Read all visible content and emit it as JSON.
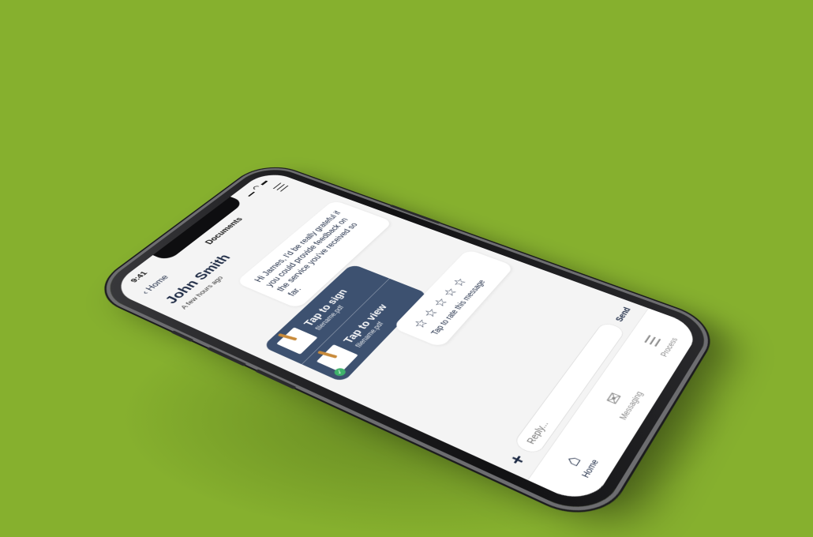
{
  "status_bar": {
    "time": "9:41"
  },
  "nav": {
    "back_label": "Home",
    "title": "Documents"
  },
  "contact": {
    "name": "John Smith",
    "timestamp": "A few hours ago"
  },
  "message": {
    "text": "Hi James, I'd be really grateful if you could provide feedback on the service you've received so far."
  },
  "documents": [
    {
      "title": "Tap to sign",
      "filename": "filename.pdf",
      "signed": false
    },
    {
      "title": "Tap to view",
      "filename": "filename.pdf",
      "signed": true
    }
  ],
  "rating": {
    "stars": [
      "☆",
      "☆",
      "☆",
      "☆",
      "☆"
    ],
    "label": "Tap to rate this message"
  },
  "composer": {
    "plus_label": "+",
    "placeholder": "Reply...",
    "send_label": "Send"
  },
  "tabbar": {
    "tabs": [
      {
        "label": "Home",
        "icon": "home-icon",
        "glyph": "⌂",
        "active": true
      },
      {
        "label": "Messaging",
        "icon": "envelope-icon",
        "glyph": "✉",
        "active": false
      },
      {
        "label": "Process",
        "icon": "numbered-list-icon",
        "glyph": "☰",
        "active": false
      }
    ]
  },
  "colors": {
    "background": "#86b02e",
    "navy": "#1d2a44",
    "card": "#3d5170",
    "check": "#3fb36b"
  }
}
